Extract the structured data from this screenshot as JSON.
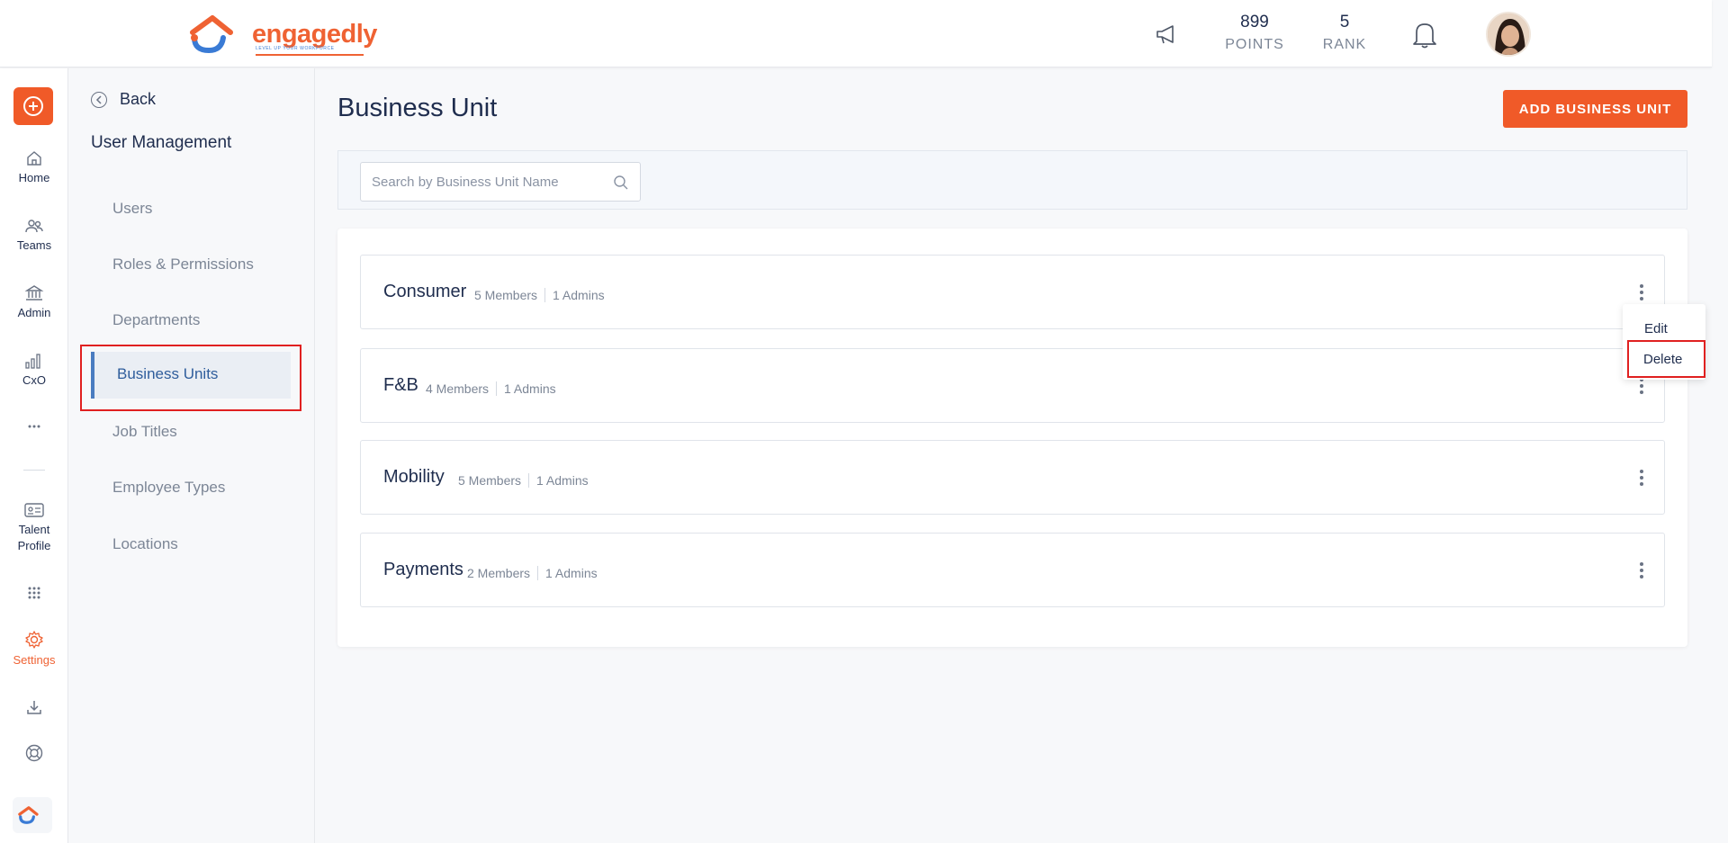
{
  "header": {
    "logo_text": "engagedly",
    "logo_tagline": "LEVEL UP YOUR WORKFORCE",
    "points_value": "899",
    "points_label": "POINTS",
    "rank_value": "5",
    "rank_label": "RANK"
  },
  "rail": {
    "items": [
      {
        "label": "Home",
        "icon": "home-icon"
      },
      {
        "label": "Teams",
        "icon": "teams-icon"
      },
      {
        "label": "Admin",
        "icon": "admin-icon"
      },
      {
        "label": "CxO",
        "icon": "chart-icon"
      },
      {
        "label": "Talent Profile",
        "icon": "id-card-icon"
      },
      {
        "label": "Settings",
        "icon": "gear-icon"
      }
    ]
  },
  "subnav": {
    "back_label": "Back",
    "title": "User Management",
    "items": [
      {
        "label": "Users"
      },
      {
        "label": "Roles & Permissions"
      },
      {
        "label": "Departments"
      },
      {
        "label": "Business Units"
      },
      {
        "label": "Job Titles"
      },
      {
        "label": "Employee Types"
      },
      {
        "label": "Locations"
      }
    ]
  },
  "main": {
    "title": "Business Unit",
    "add_button": "ADD BUSINESS UNIT",
    "search_placeholder": "Search by Business Unit Name",
    "units": [
      {
        "name": "Consumer",
        "members": "5 Members",
        "admins": "1 Admins"
      },
      {
        "name": "F&B",
        "members": "4 Members",
        "admins": "1 Admins"
      },
      {
        "name": "Mobility",
        "members": "5 Members",
        "admins": "1 Admins"
      },
      {
        "name": "Payments",
        "members": "2 Members",
        "admins": "1 Admins"
      }
    ]
  },
  "menu": {
    "edit": "Edit",
    "delete": "Delete"
  },
  "colors": {
    "accent": "#f05a28",
    "active_nav": "#4a7cc0",
    "highlight": "#e02020"
  }
}
